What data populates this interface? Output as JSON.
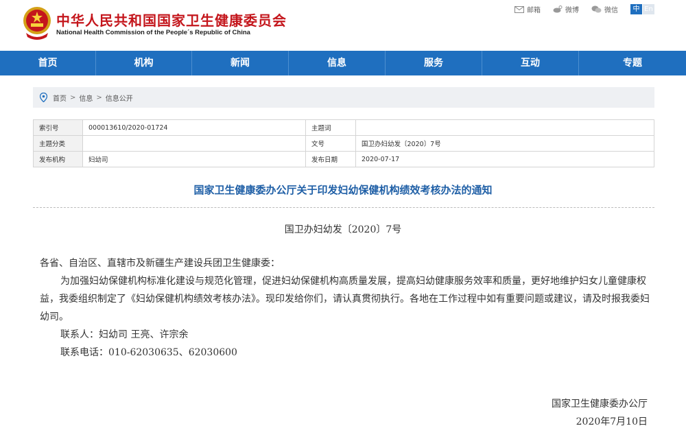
{
  "header": {
    "site_title_cn": "中华人民共和国国家卫生健康委员会",
    "site_title_en": "National Health Commission of the People´s Republic of China",
    "links": [
      {
        "label": "邮箱",
        "icon": "mail-icon"
      },
      {
        "label": "微博",
        "icon": "weibo-icon"
      },
      {
        "label": "微信",
        "icon": "wechat-icon"
      }
    ],
    "lang_cn": "中",
    "lang_en": "En"
  },
  "nav": {
    "items": [
      "首页",
      "机构",
      "新闻",
      "信息",
      "服务",
      "互动",
      "专题"
    ]
  },
  "breadcrumb": {
    "items": [
      "首页",
      "信息",
      "信息公开"
    ],
    "separator": ">"
  },
  "meta": {
    "index_label": "索引号",
    "index_value": "000013610/2020-01724",
    "keyword_label": "主题词",
    "keyword_value": "",
    "category_label": "主题分类",
    "category_value": "",
    "docnum_label": "文号",
    "docnum_value": "国卫办妇幼发〔2020〕7号",
    "issuer_label": "发布机构",
    "issuer_value": "妇幼司",
    "date_label": "发布日期",
    "date_value": "2020-07-17"
  },
  "article": {
    "title": "国家卫生健康委办公厅关于印发妇幼保健机构绩效考核办法的通知",
    "doc_number": "国卫办妇幼发〔2020〕7号",
    "salutation": "各省、自治区、直辖市及新疆生产建设兵团卫生健康委：",
    "paragraph": "为加强妇幼保健机构标准化建设与规范化管理，促进妇幼保健机构高质量发展，提高妇幼健康服务效率和质量，更好地维护妇女儿童健康权益，我委组织制定了《妇幼保健机构绩效考核办法》。现印发给你们，请认真贯彻执行。各地在工作过程中如有重要问题或建议，请及时报我委妇幼司。",
    "contact": "联系人：妇幼司 王亮、许宗余",
    "phone": "联系电话：010-62030635、62030600",
    "signature": "国家卫生健康委办公厅",
    "sign_date": "2020年7月10日"
  },
  "colors": {
    "brand_red": "#c4161c",
    "nav_blue": "#1f6fbf",
    "title_blue": "#1f5fa6"
  }
}
